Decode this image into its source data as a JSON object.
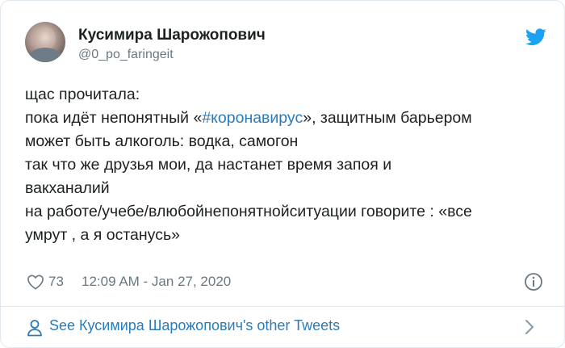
{
  "tweet": {
    "author_name": "Кусимира Шарожопович",
    "author_handle": "@0_po_faringeit",
    "lines": {
      "l1": "щас прочитала:",
      "l2_before": "пока идёт непонятный «",
      "l2_hashtag": "#коронавирус",
      "l2_after": "», защитным барьером",
      "l3": "может быть алкоголь: водка, самогон",
      "l4": "так что же друзья мои, да настанет время запоя и",
      "l5": "вакханалий",
      "l6": "на работе/учебе/влюбойнепонятнойситуации говорите : «все",
      "l7": "умрут , а я останусь»"
    },
    "like_count": "73",
    "timestamp": "12:09 AM - Jan 27, 2020"
  },
  "footer": {
    "link_label": "See Кусимира Шарожопович's other Tweets"
  },
  "icons": {
    "brand": "twitter-bird-icon",
    "like": "heart-icon",
    "info": "info-icon",
    "person": "person-icon",
    "chevron": "chevron-right-icon"
  },
  "colors": {
    "brand_blue": "#1da1f2",
    "link_blue": "#2b7bb9",
    "text": "#1c2022",
    "muted": "#697882",
    "border": "#e1e8ed"
  }
}
